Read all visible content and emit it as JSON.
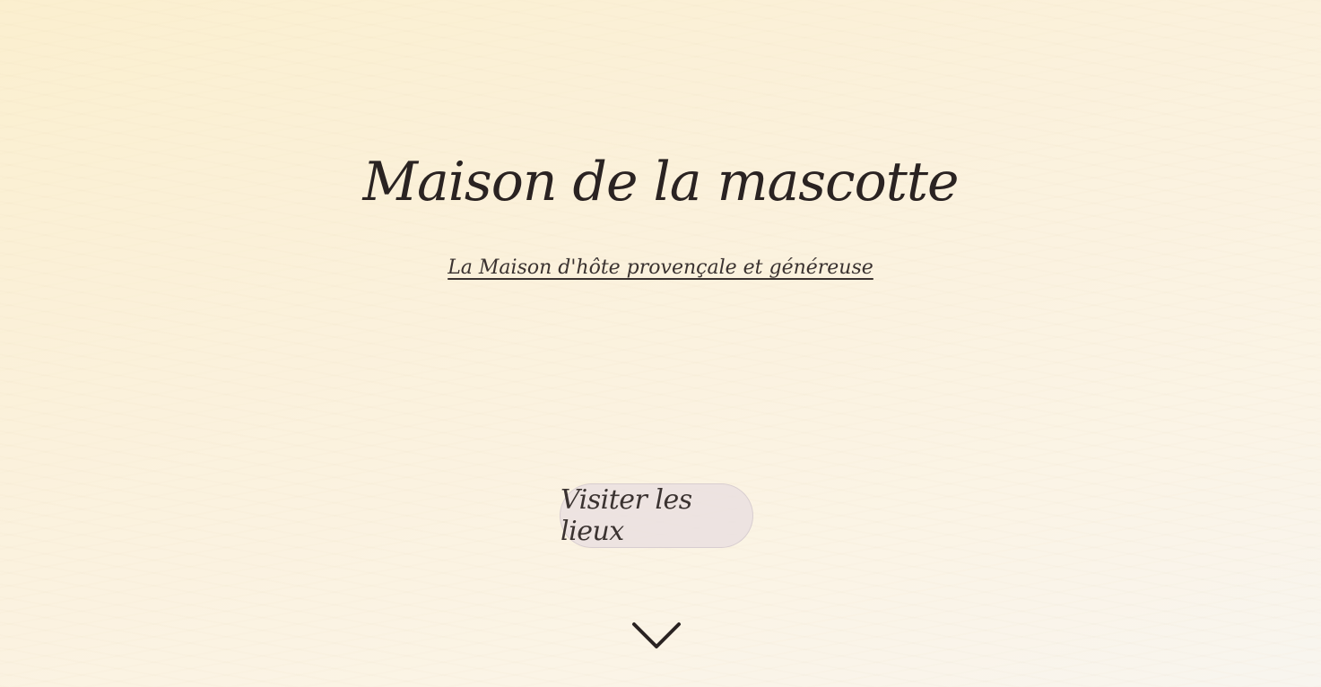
{
  "hero": {
    "title": "Maison de la mascotte",
    "subtitle": "La Maison d'hôte provençale et généreuse",
    "cta_label": "Visiter les lieux",
    "scroll_icon": "chevron-down-icon"
  },
  "colors": {
    "text": "#2a2322",
    "background_start": "#fbefcf",
    "background_end": "#f8f5ef",
    "button_fill": "#e8dee0"
  }
}
